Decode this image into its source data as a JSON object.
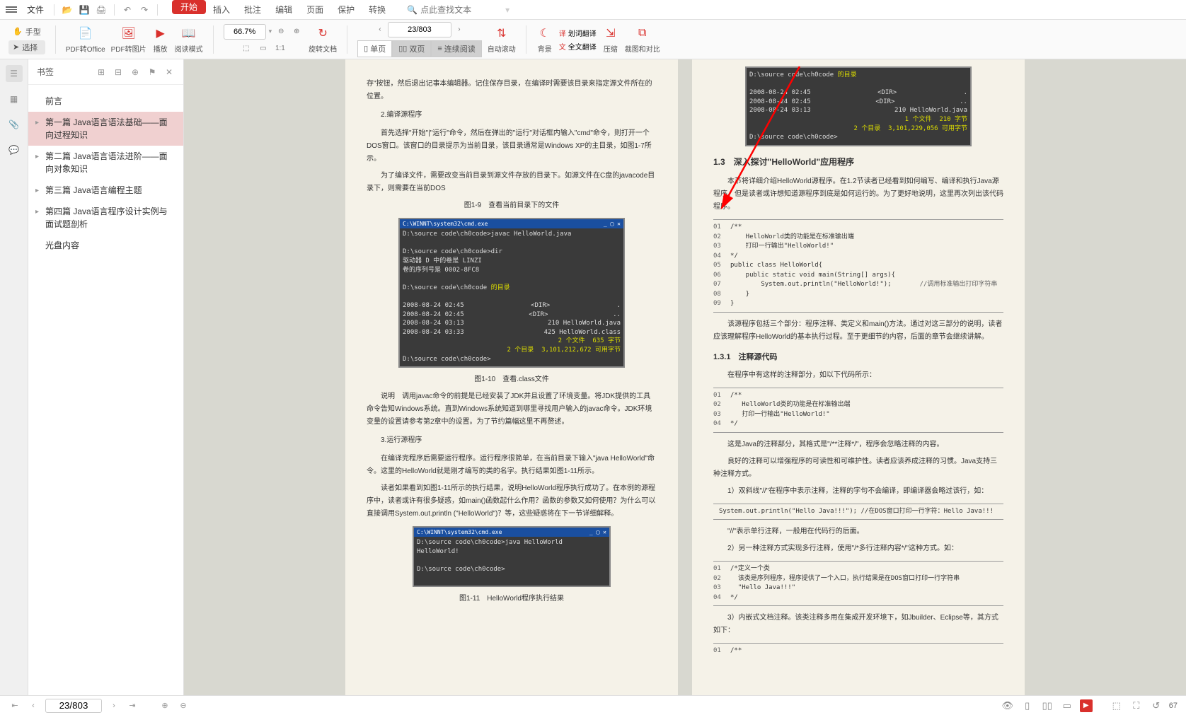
{
  "topbar": {
    "file": "文件",
    "tabs": {
      "start": "开始",
      "insert": "插入",
      "review": "批注",
      "edit": "编辑",
      "page": "页面",
      "protect": "保护",
      "convert": "转换"
    },
    "search_placeholder": "点此查找文本"
  },
  "ribbon": {
    "hand": "手型",
    "select": "选择",
    "pdf_office": "PDF转Office",
    "pdf_image": "PDF转图片",
    "play": "播放",
    "read_mode": "阅读模式",
    "zoom": "66.7%",
    "rotate": "旋转文档",
    "page_input": "23/803",
    "single": "单页",
    "double": "双页",
    "continuous": "连续阅读",
    "auto_scroll": "自动滚动",
    "background": "背景",
    "word_translate": "划词翻译",
    "full_translate": "全文翻译",
    "compress": "压缩",
    "crop_compare": "裁图和对比"
  },
  "sidebar": {
    "title": "书签",
    "items": [
      {
        "label": "前言",
        "chev": ""
      },
      {
        "label": "第一篇 Java语言语法基础——面向过程知识",
        "chev": "▸",
        "hl": true
      },
      {
        "label": "第二篇 Java语言语法进阶——面向对象知识",
        "chev": "▸"
      },
      {
        "label": "第三篇 Java语言编程主题",
        "chev": "▸"
      },
      {
        "label": "第四篇 Java语言程序设计实例与面试题剖析",
        "chev": "▸"
      },
      {
        "label": "光盘内容",
        "chev": ""
      }
    ]
  },
  "left_page": {
    "p1": "存\"按钮，然后退出记事本编辑器。记住保存目录，在编译时需要该目录来指定源文件所在的位置。",
    "s2": "2.编译源程序",
    "p3": "首先选择\"开始\"|\"运行\"命令，然后在弹出的\"运行\"对话框内输入\"cmd\"命令，则打开一个DOS窗口。该窗口的目录提示为当前目录，该目录通常是Windows XP的主目录，如图1-7所示。",
    "p4": "为了编译文件，需要改变当前目录到源文件存放的目录下。如源文件在C盘的javacode目录下，则需要在当前DOS",
    "cap1": "图1-9　查看当前目录下的文件",
    "cmd1": {
      "title": "C:\\WINNT\\system32\\cmd.exe",
      "l1": "D:\\source code\\ch0code>javac HelloWorld.java",
      "l2": "D:\\source code\\ch0code>dir",
      "l3": "驱动器 D 中的卷是 LINZI",
      "l4": "卷的序列号是 0002-8FC8",
      "l5a": "D:\\source code\\ch0code ",
      "l5b": "的目录",
      "r1a": "2008-08-24  02:45",
      "r1b": "<DIR>",
      "r1c": ".",
      "r2a": "2008-08-24  02:45",
      "r2b": "<DIR>",
      "r2c": "..",
      "r3a": "2008-08-24  03:13",
      "r3b": "210 HelloWorld.java",
      "r4a": "2008-08-24  03:33",
      "r4b": "425 HelloWorld.class",
      "s1a": "2 个文件",
      "s1b": "635 字节",
      "s2a": "2 个目录",
      "s2b": "3,101,212,672 可用字节",
      "lend": "D:\\source code\\ch0code>"
    },
    "cap2": "图1-10　查看.class文件",
    "p5": "说明　调用javac命令的前提是已经安装了JDK并且设置了环境变量。将JDK提供的工具命令告知Windows系统。直到Windows系统知道到哪里寻找用户输入的javac命令。JDK环境变量的设置请参考第2章中的设置。为了节约篇幅这里不再赘述。",
    "s3": "3.运行源程序",
    "p6": "在编译完程序后需要运行程序。运行程序很简单，在当前目录下输入\"java HelloWorld\"命令。这里的HelloWorld就是刚才编写的类的名字。执行结果如图1-11所示。",
    "p7": "读者如果看到如图1-11所示的执行结果，说明HelloWorld程序执行成功了。在本例的源程序中，读者或许有很多疑惑，如main()函数起什么作用？函数的参数又如何使用？为什么可以直接调用System.out.println (\"HelloWorld\")？等，这些疑惑将在下一节详细解释。",
    "cmd2": {
      "title": "C:\\WINNT\\system32\\cmd.exe",
      "l1": "D:\\source code\\ch0code>java HelloWorld",
      "l2": "HelloWorld!",
      "l3": "D:\\source code\\ch0code>"
    },
    "cap3": "图1-11　HelloWorld程序执行结果"
  },
  "right_page": {
    "cmd0": {
      "l1a": "D:\\source code\\ch0code ",
      "l1b": "的目录",
      "r1a": "2008-08-24  02:45",
      "r1b": "<DIR>",
      "r1c": ".",
      "r2a": "2008-08-24  02:45",
      "r2b": "<DIR>",
      "r2c": "..",
      "r3a": "2008-08-24  03:13",
      "r3b": "210 HelloWorld.java",
      "s1a": "1 个文件",
      "s1b": "210 字节",
      "s2a": "2 个目录",
      "s2b": "3,101,229,056 可用字节",
      "lend": "D:\\source code\\ch0code>"
    },
    "h1": "1.3　深入探讨\"HelloWorld\"应用程序",
    "p1": "本节将详细介绍HelloWorld源程序。在1.2节读者已经看到如何编写、编译和执行Java源程序。但是读者或许想知道源程序到底是如何运行的。为了更好地说明，这里再次列出该代码程序。",
    "code1": [
      {
        "n": "01",
        "c": "/**"
      },
      {
        "n": "02",
        "c": "    HelloWorld类的功能是在标准输出端"
      },
      {
        "n": "03",
        "c": "    打印一行输出\"HelloWorld!\""
      },
      {
        "n": "04",
        "c": "*/"
      },
      {
        "n": "05",
        "c": "public class HelloWorld{"
      },
      {
        "n": "06",
        "c": "    public static void main(String[] args){"
      },
      {
        "n": "07",
        "c": "        System.out.println(\"HelloWorld!\");",
        "cm": "//调用标准输出打印字符串"
      },
      {
        "n": "08",
        "c": "    }"
      },
      {
        "n": "09",
        "c": "}"
      }
    ],
    "p2": "该源程序包括三个部分：程序注释、类定义和main()方法。通过对这三部分的说明，读者应该理解程序HelloWorld的基本执行过程。至于更细节的内容，后面的章节会继续讲解。",
    "h2": "1.3.1　注释源代码",
    "p3": "在程序中有这样的注释部分，如以下代码所示：",
    "code2": [
      {
        "n": "01",
        "c": "/**"
      },
      {
        "n": "02",
        "c": "   HelloWorld类的功能是在标准输出端"
      },
      {
        "n": "03",
        "c": "   打印一行输出\"HelloWorld!\""
      },
      {
        "n": "04",
        "c": "*/"
      }
    ],
    "p4": "这是Java的注释部分，其格式是\"/**注释*/\"，程序会忽略注释的内容。",
    "p5": "良好的注释可以增强程序的可读性和可维护性。读者应该养成注释的习惯。Java支持三种注释方式。",
    "p6": "1）双斜线\"//\"在程序中表示注释，注释的字句不会编译，即编译器会略过该行，如：",
    "code3": "System.out.println(\"Hello Java!!!\");    //在DOS窗口打印一行字符：Hello Java!!!",
    "p7": "\"//\"表示单行注释，一般用在代码行的后面。",
    "p8": "2）另一种注释方式实现多行注释，使用\"/*多行注释内容*/\"这种方式。如：",
    "code4": [
      {
        "n": "01",
        "c": "/*定义一个类"
      },
      {
        "n": "02",
        "c": "  该类是序列程序，程序提供了一个入口，执行结果是在DOS窗口打印一行字符串"
      },
      {
        "n": "03",
        "c": "  \"Hello Java!!!\""
      },
      {
        "n": "04",
        "c": "*/"
      }
    ],
    "p9": "3）内嵌式文档注释。该类注释多用在集成开发环境下，如Jbuilder、Eclipse等，其方式如下：",
    "code5": [
      {
        "n": "01",
        "c": "/**"
      }
    ]
  },
  "statusbar": {
    "page": "23/803",
    "zoom": "67"
  }
}
